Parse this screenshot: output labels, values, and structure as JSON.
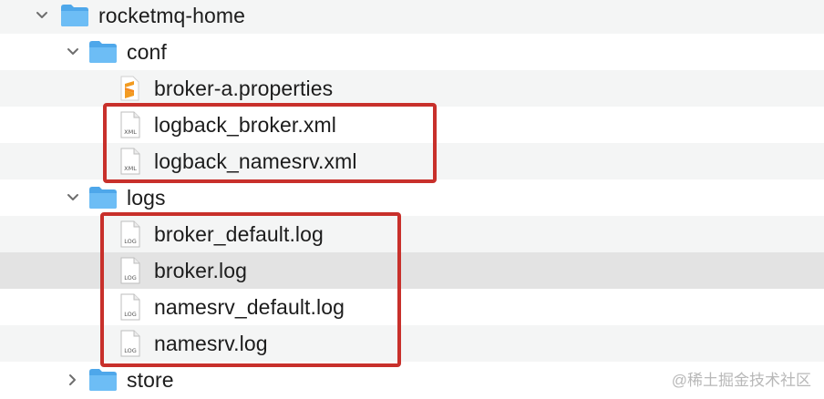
{
  "tree": {
    "root": {
      "label": "rocketmq-home",
      "icon": "folder-icon",
      "expanded": true
    },
    "conf": {
      "label": "conf",
      "icon": "folder-icon",
      "expanded": true
    },
    "conf_files": [
      {
        "label": "broker-a.properties",
        "icon": "sublime-text-file-icon"
      },
      {
        "label": "logback_broker.xml",
        "icon": "xml-file-icon",
        "badge": "XML"
      },
      {
        "label": "logback_namesrv.xml",
        "icon": "xml-file-icon",
        "badge": "XML"
      }
    ],
    "logs": {
      "label": "logs",
      "icon": "folder-icon",
      "expanded": true
    },
    "log_files": [
      {
        "label": "broker_default.log",
        "icon": "log-file-icon",
        "badge": "LOG"
      },
      {
        "label": "broker.log",
        "icon": "log-file-icon",
        "badge": "LOG",
        "selected": true
      },
      {
        "label": "namesrv_default.log",
        "icon": "log-file-icon",
        "badge": "LOG"
      },
      {
        "label": "namesrv.log",
        "icon": "log-file-icon",
        "badge": "LOG"
      }
    ],
    "store": {
      "label": "store",
      "icon": "folder-icon",
      "expanded": false
    }
  },
  "watermark": "@稀土掘金技术社区",
  "colors": {
    "folder": "#5fb4f0",
    "highlight_box": "#c8302b",
    "selected_row": "#e3e3e3",
    "alt_row": "#f4f5f5"
  }
}
